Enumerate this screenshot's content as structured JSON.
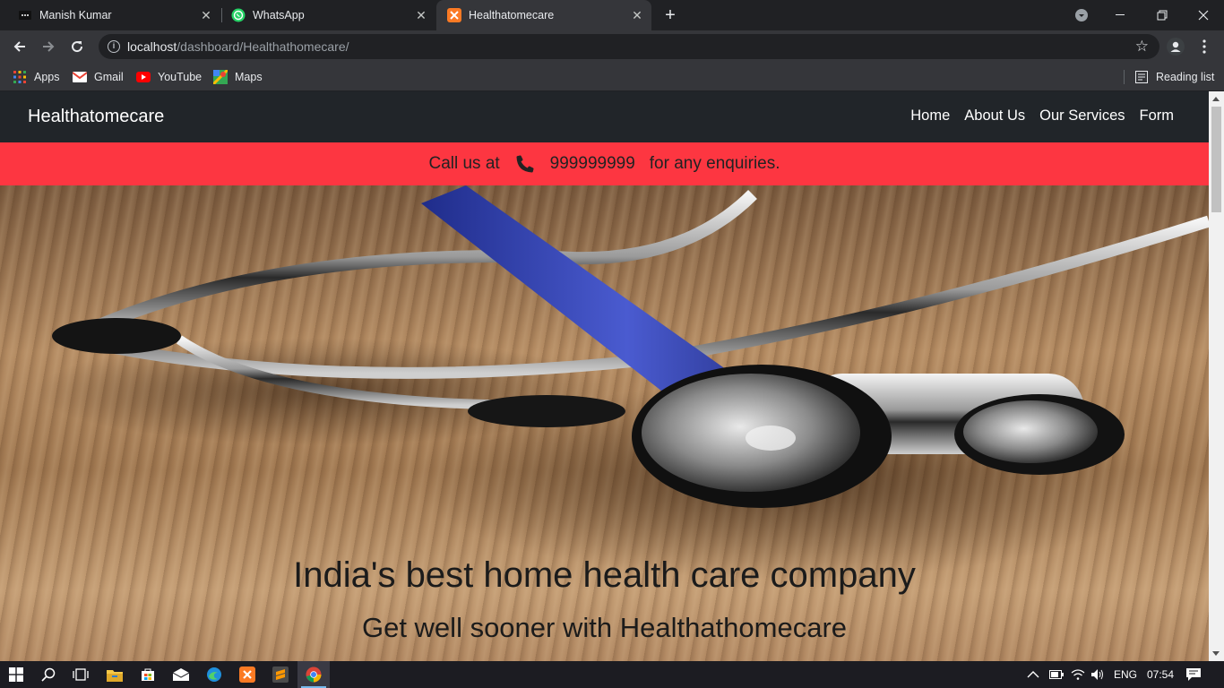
{
  "browser": {
    "tabs": [
      {
        "title": "Manish Kumar",
        "active": false
      },
      {
        "title": "WhatsApp",
        "active": false
      },
      {
        "title": "Healthatomecare",
        "active": true
      }
    ],
    "url_host": "localhost",
    "url_path": "/dashboard/Healthathomecare/",
    "bookmarks": [
      "Apps",
      "Gmail",
      "YouTube",
      "Maps"
    ],
    "reading_list": "Reading list"
  },
  "site": {
    "brand": "Healthatomecare",
    "menu": [
      "Home",
      "About Us",
      "Our Services",
      "Form"
    ],
    "call_prefix": "Call us at",
    "phone": "999999999",
    "call_suffix": "for any enquiries.",
    "hero_title": "India's best home health care company",
    "hero_subtitle": "Get well sooner with Healthathomecare"
  },
  "taskbar": {
    "language": "ENG",
    "time": "07:54"
  },
  "colors": {
    "nav_bg": "#212529",
    "call_bar_bg": "#fd3641",
    "chrome_dark": "#202124",
    "chrome_toolbar": "#35363a"
  }
}
